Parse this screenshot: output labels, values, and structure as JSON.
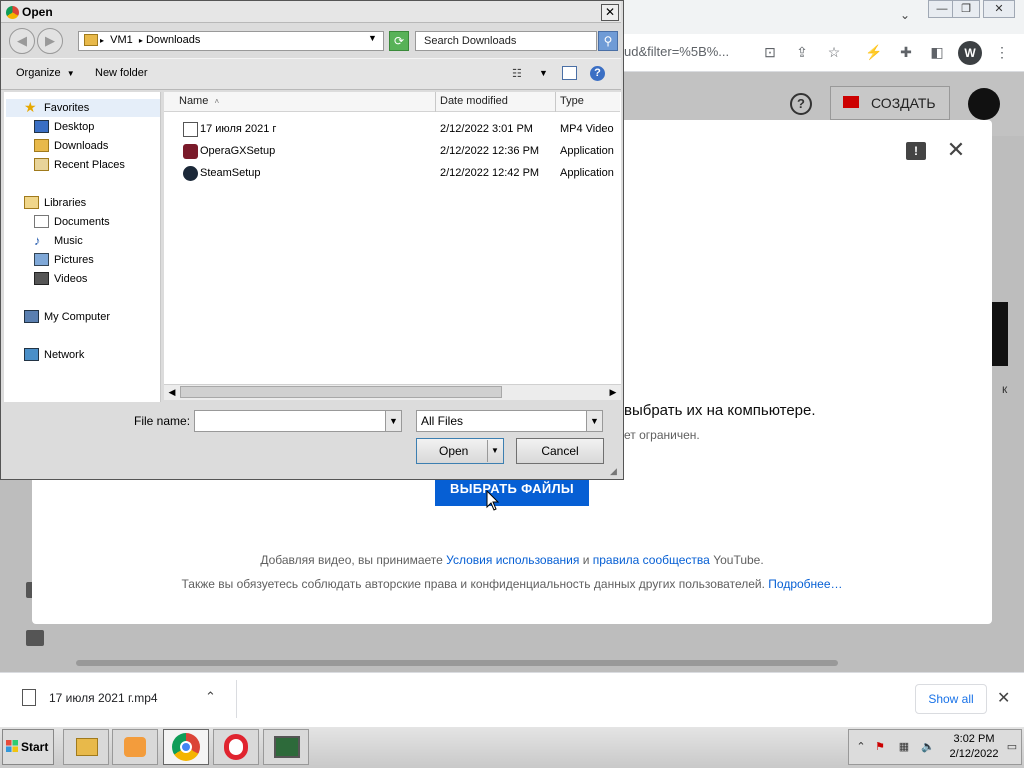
{
  "browser": {
    "url_tail": "ud&filter=%5B%...",
    "profile_initial": "W",
    "win_controls": [
      "—",
      "❐",
      "✕"
    ]
  },
  "youtube": {
    "create_label": "СОЗДАТЬ",
    "help_glyph": "?",
    "right_edge_text": "к",
    "modal": {
      "line1": "выбрать их на компьютере.",
      "line2": "ет ограничен.",
      "select_files_label": "ВЫБРАТЬ ФАЙЛЫ",
      "terms1_prefix": "Добавляя видео, вы принимаете ",
      "terms1_link1": "Условия использования",
      "terms1_and": " и ",
      "terms1_link2": "правила сообщества",
      "terms1_suffix": " YouTube.",
      "terms2_text": "Также вы обязуетесь соблюдать авторские права и конфиденциальность данных других пользователей. ",
      "terms2_link": "Подробнее…"
    }
  },
  "download_shelf": {
    "file_name": "17 июля 2021 г.mp4",
    "show_all": "Show all"
  },
  "taskbar": {
    "start_label": "Start",
    "time": "3:02 PM",
    "date": "2/12/2022"
  },
  "dialog": {
    "title": "Open",
    "breadcrumb": [
      "VM1",
      "Downloads"
    ],
    "search_placeholder": "Search Downloads",
    "toolbar": {
      "organize": "Organize",
      "new_folder": "New folder"
    },
    "nav": {
      "favorites": "Favorites",
      "desktop": "Desktop",
      "downloads": "Downloads",
      "recent_places": "Recent Places",
      "libraries": "Libraries",
      "documents": "Documents",
      "music": "Music",
      "pictures": "Pictures",
      "videos": "Videos",
      "my_computer": "My Computer",
      "network": "Network"
    },
    "columns": {
      "name": "Name",
      "date_modified": "Date modified",
      "type": "Type"
    },
    "files": [
      {
        "name": "17 июля 2021 г",
        "date": "2/12/2022 3:01 PM",
        "type": "MP4 Video"
      },
      {
        "name": "OperaGXSetup",
        "date": "2/12/2022 12:36 PM",
        "type": "Application"
      },
      {
        "name": "SteamSetup",
        "date": "2/12/2022 12:42 PM",
        "type": "Application"
      }
    ],
    "file_name_label": "File name:",
    "file_name_value": "",
    "filter_value": "All Files",
    "open_label": "Open",
    "cancel_label": "Cancel"
  }
}
